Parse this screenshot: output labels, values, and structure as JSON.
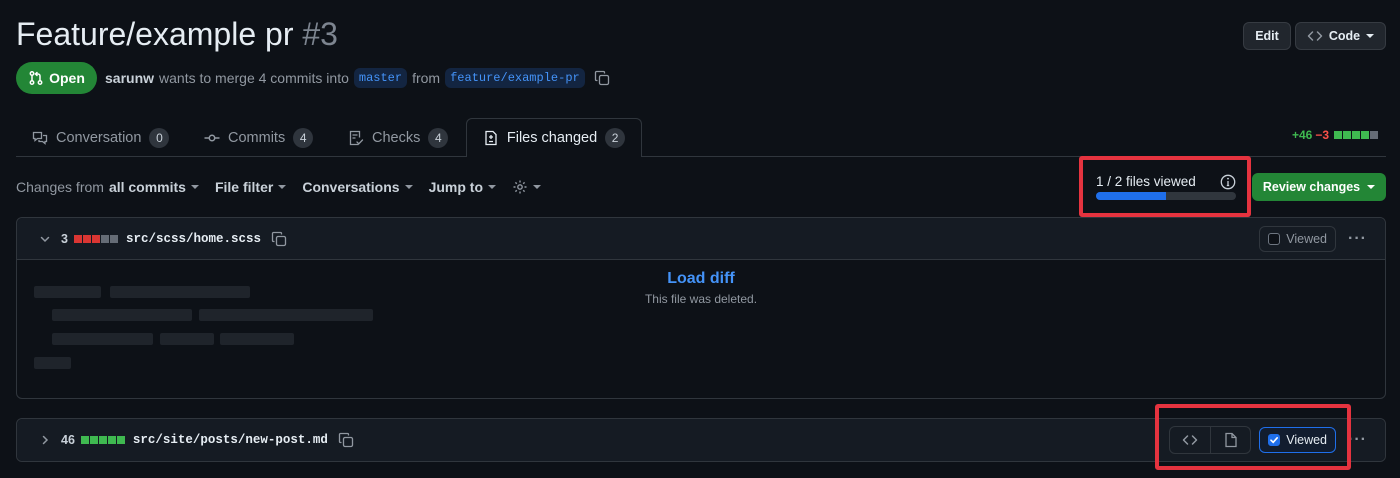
{
  "pr": {
    "title": "Feature/example pr",
    "number": "#3",
    "state": "Open",
    "author": "sarunw",
    "merge_text": "wants to merge 4 commits into",
    "base_branch": "master",
    "from_text": "from",
    "head_branch": "feature/example-pr"
  },
  "header": {
    "edit_label": "Edit",
    "code_label": "Code"
  },
  "tabs": [
    {
      "label": "Conversation",
      "count": "0"
    },
    {
      "label": "Commits",
      "count": "4"
    },
    {
      "label": "Checks",
      "count": "4"
    },
    {
      "label": "Files changed",
      "count": "2",
      "active": true
    }
  ],
  "diffstat": {
    "additions": "+46",
    "deletions": "−3"
  },
  "toolbar": {
    "changes_prefix": "Changes from",
    "changes_value": "all commits",
    "file_filter": "File filter",
    "conversations": "Conversations",
    "jump_to": "Jump to"
  },
  "progress": {
    "label": "1 / 2 files viewed",
    "viewed": 1,
    "total": 2
  },
  "review_button": "Review changes",
  "files": [
    {
      "changes": "3",
      "name": "src/scss/home.scss",
      "viewed_label": "Viewed",
      "viewed": false,
      "load_diff": "Load diff",
      "note": "This file was deleted."
    },
    {
      "changes": "46",
      "name": "src/site/posts/new-post.md",
      "viewed_label": "Viewed",
      "viewed": true
    }
  ],
  "colors": {
    "accent": "#1f6feb",
    "success": "#238636",
    "danger": "#da3633",
    "highlight": "#e5333f"
  }
}
